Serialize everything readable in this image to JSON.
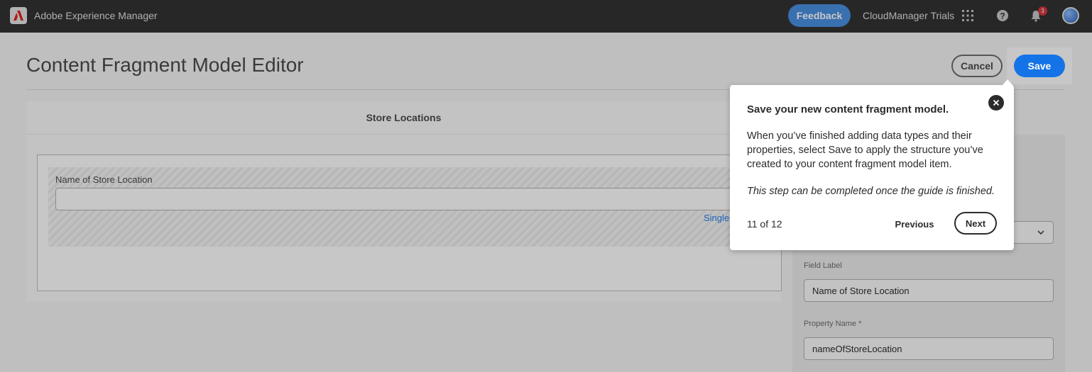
{
  "topbar": {
    "app_title": "Adobe Experience Manager",
    "feedback_label": "Feedback",
    "org_name": "CloudManager Trials",
    "notification_count": "3",
    "icons": [
      "adobe-logo-icon",
      "apps-grid-icon",
      "help-icon",
      "bell-icon"
    ]
  },
  "header": {
    "title": "Content Fragment Model Editor",
    "cancel_label": "Cancel",
    "save_label": "Save"
  },
  "canvas": {
    "model_name": "Store Locations",
    "field": {
      "label": "Name of Store Location",
      "value": "",
      "type_hint": "Single"
    }
  },
  "properties": {
    "field_label_caption": "Field Label",
    "field_label_value": "Name of Store Location",
    "property_name_caption": "Property Name *",
    "property_name_value": "nameOfStoreLocation"
  },
  "guide": {
    "title": "Save your new content fragment model.",
    "body": "When you’ve finished adding data types and their properties, select Save to apply the structure you’ve created to your content fragment model item.",
    "note": "This step can be completed once the guide is finished.",
    "step": "11 of 12",
    "previous_label": "Previous",
    "next_label": "Next"
  },
  "colors": {
    "accent": "#1473e6",
    "topbar": "#323232",
    "feedback": "#4a90e2",
    "badge": "#d7373f"
  }
}
